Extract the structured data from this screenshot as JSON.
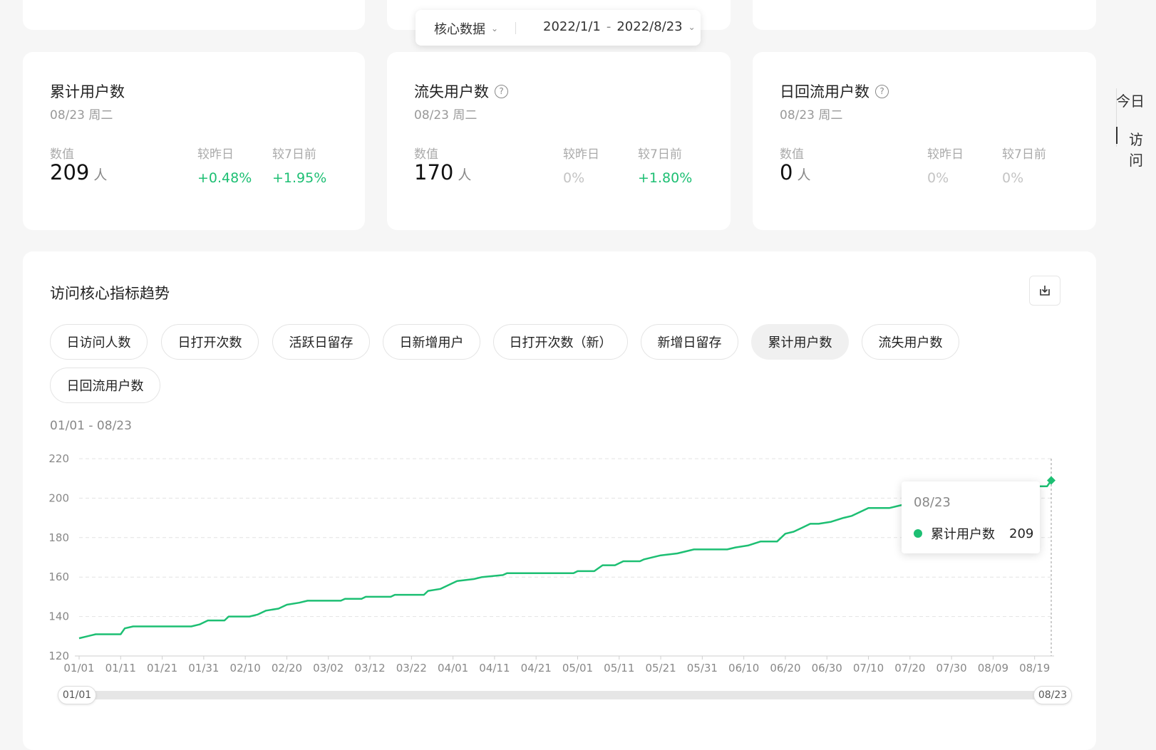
{
  "filter": {
    "metric_label": "核心数据",
    "date_start": "2022/1/1",
    "date_sep": "-",
    "date_end": "2022/8/23"
  },
  "cards": [
    {
      "title": "累计用户数",
      "date": "08/23 周二",
      "value_label": "数值",
      "value": "209",
      "unit": "人",
      "vs_day_label": "较昨日",
      "vs_day": "+0.48%",
      "vs_week_label": "较7日前",
      "vs_week": "+1.95%",
      "has_help": false
    },
    {
      "title": "流失用户数",
      "date": "08/23 周二",
      "value_label": "数值",
      "value": "170",
      "unit": "人",
      "vs_day_label": "较昨日",
      "vs_day": "0%",
      "vs_week_label": "较7日前",
      "vs_week": "+1.80%",
      "has_help": true
    },
    {
      "title": "日回流用户数",
      "date": "08/23 周二",
      "value_label": "数值",
      "value": "0",
      "unit": "人",
      "vs_day_label": "较昨日",
      "vs_day": "0%",
      "vs_week_label": "较7日前",
      "vs_week": "0%",
      "has_help": true
    }
  ],
  "side_nav": [
    "今日",
    "访问"
  ],
  "trend": {
    "title": "访问核心指标趋势",
    "pills": [
      "日访问人数",
      "日打开次数",
      "活跃日留存",
      "日新增用户",
      "日打开次数（新）",
      "新增日留存",
      "累计用户数",
      "流失用户数",
      "日回流用户数"
    ],
    "active_pill": "累计用户数",
    "range_label": "01/01 - 08/23",
    "tooltip": {
      "date": "08/23",
      "series": "累计用户数",
      "value": "209"
    },
    "slider": {
      "start": "01/01",
      "end": "08/23"
    }
  },
  "colors": {
    "accent": "#1dbf73",
    "positive": "#1dbf73"
  },
  "chart_data": {
    "type": "line",
    "series": [
      {
        "name": "累计用户数",
        "points": [
          [
            "01/01",
            129
          ],
          [
            "01/03",
            130
          ],
          [
            "01/05",
            131
          ],
          [
            "01/11",
            131
          ],
          [
            "01/12",
            134
          ],
          [
            "01/14",
            135
          ],
          [
            "01/28",
            135
          ],
          [
            "01/30",
            136
          ],
          [
            "02/01",
            138
          ],
          [
            "02/05",
            138
          ],
          [
            "02/06",
            140
          ],
          [
            "02/11",
            140
          ],
          [
            "02/13",
            141
          ],
          [
            "02/15",
            143
          ],
          [
            "02/18",
            144
          ],
          [
            "02/20",
            146
          ],
          [
            "02/23",
            147
          ],
          [
            "02/25",
            148
          ],
          [
            "03/05",
            148
          ],
          [
            "03/06",
            149
          ],
          [
            "03/10",
            149
          ],
          [
            "03/11",
            150
          ],
          [
            "03/17",
            150
          ],
          [
            "03/18",
            151
          ],
          [
            "03/25",
            151
          ],
          [
            "03/26",
            153
          ],
          [
            "03/29",
            154
          ],
          [
            "04/02",
            158
          ],
          [
            "04/06",
            159
          ],
          [
            "04/08",
            160
          ],
          [
            "04/13",
            161
          ],
          [
            "04/14",
            162
          ],
          [
            "04/30",
            162
          ],
          [
            "05/01",
            163
          ],
          [
            "05/05",
            163
          ],
          [
            "05/07",
            166
          ],
          [
            "05/10",
            166
          ],
          [
            "05/12",
            168
          ],
          [
            "05/16",
            168
          ],
          [
            "05/17",
            169
          ],
          [
            "05/21",
            171
          ],
          [
            "05/25",
            172
          ],
          [
            "05/29",
            174
          ],
          [
            "06/06",
            174
          ],
          [
            "06/08",
            175
          ],
          [
            "06/11",
            176
          ],
          [
            "06/14",
            178
          ],
          [
            "06/18",
            178
          ],
          [
            "06/20",
            182
          ],
          [
            "06/22",
            183
          ],
          [
            "06/24",
            185
          ],
          [
            "06/26",
            187
          ],
          [
            "06/28",
            187
          ],
          [
            "07/01",
            188
          ],
          [
            "07/04",
            190
          ],
          [
            "07/06",
            191
          ],
          [
            "07/09",
            194
          ],
          [
            "07/10",
            195
          ],
          [
            "07/15",
            195
          ],
          [
            "07/17",
            196
          ],
          [
            "07/19",
            197
          ],
          [
            "07/29",
            198
          ],
          [
            "08/01",
            200
          ],
          [
            "08/05",
            202
          ],
          [
            "08/10",
            203
          ],
          [
            "08/15",
            205
          ],
          [
            "08/20",
            206
          ],
          [
            "08/22",
            206
          ],
          [
            "08/23",
            209
          ]
        ]
      }
    ],
    "x_ticks": [
      "01/01",
      "01/11",
      "01/21",
      "01/31",
      "02/10",
      "02/20",
      "03/02",
      "03/12",
      "03/22",
      "04/01",
      "04/11",
      "04/21",
      "05/01",
      "05/11",
      "05/21",
      "05/31",
      "06/10",
      "06/20",
      "06/30",
      "07/10",
      "07/20",
      "07/30",
      "08/09",
      "08/19"
    ],
    "y_ticks": [
      120,
      140,
      160,
      180,
      200,
      220
    ],
    "ylim": [
      120,
      220
    ],
    "x_range": [
      "01/01",
      "08/23"
    ],
    "grid": true,
    "legend": "none"
  }
}
